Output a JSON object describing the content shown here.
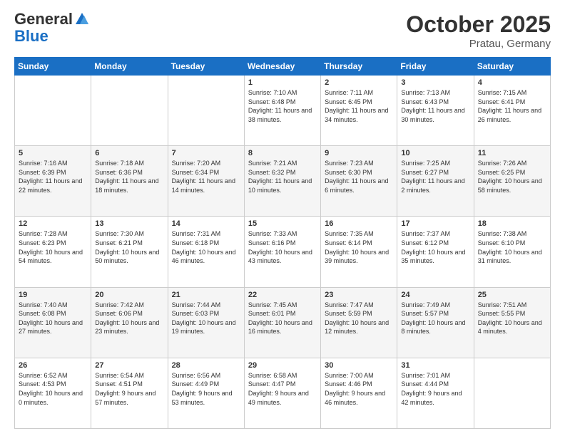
{
  "header": {
    "logo_general": "General",
    "logo_blue": "Blue",
    "month_title": "October 2025",
    "location": "Pratau, Germany"
  },
  "days_of_week": [
    "Sunday",
    "Monday",
    "Tuesday",
    "Wednesday",
    "Thursday",
    "Friday",
    "Saturday"
  ],
  "weeks": [
    [
      {
        "day": "",
        "sunrise": "",
        "sunset": "",
        "daylight": ""
      },
      {
        "day": "",
        "sunrise": "",
        "sunset": "",
        "daylight": ""
      },
      {
        "day": "",
        "sunrise": "",
        "sunset": "",
        "daylight": ""
      },
      {
        "day": "1",
        "sunrise": "Sunrise: 7:10 AM",
        "sunset": "Sunset: 6:48 PM",
        "daylight": "Daylight: 11 hours and 38 minutes."
      },
      {
        "day": "2",
        "sunrise": "Sunrise: 7:11 AM",
        "sunset": "Sunset: 6:45 PM",
        "daylight": "Daylight: 11 hours and 34 minutes."
      },
      {
        "day": "3",
        "sunrise": "Sunrise: 7:13 AM",
        "sunset": "Sunset: 6:43 PM",
        "daylight": "Daylight: 11 hours and 30 minutes."
      },
      {
        "day": "4",
        "sunrise": "Sunrise: 7:15 AM",
        "sunset": "Sunset: 6:41 PM",
        "daylight": "Daylight: 11 hours and 26 minutes."
      }
    ],
    [
      {
        "day": "5",
        "sunrise": "Sunrise: 7:16 AM",
        "sunset": "Sunset: 6:39 PM",
        "daylight": "Daylight: 11 hours and 22 minutes."
      },
      {
        "day": "6",
        "sunrise": "Sunrise: 7:18 AM",
        "sunset": "Sunset: 6:36 PM",
        "daylight": "Daylight: 11 hours and 18 minutes."
      },
      {
        "day": "7",
        "sunrise": "Sunrise: 7:20 AM",
        "sunset": "Sunset: 6:34 PM",
        "daylight": "Daylight: 11 hours and 14 minutes."
      },
      {
        "day": "8",
        "sunrise": "Sunrise: 7:21 AM",
        "sunset": "Sunset: 6:32 PM",
        "daylight": "Daylight: 11 hours and 10 minutes."
      },
      {
        "day": "9",
        "sunrise": "Sunrise: 7:23 AM",
        "sunset": "Sunset: 6:30 PM",
        "daylight": "Daylight: 11 hours and 6 minutes."
      },
      {
        "day": "10",
        "sunrise": "Sunrise: 7:25 AM",
        "sunset": "Sunset: 6:27 PM",
        "daylight": "Daylight: 11 hours and 2 minutes."
      },
      {
        "day": "11",
        "sunrise": "Sunrise: 7:26 AM",
        "sunset": "Sunset: 6:25 PM",
        "daylight": "Daylight: 10 hours and 58 minutes."
      }
    ],
    [
      {
        "day": "12",
        "sunrise": "Sunrise: 7:28 AM",
        "sunset": "Sunset: 6:23 PM",
        "daylight": "Daylight: 10 hours and 54 minutes."
      },
      {
        "day": "13",
        "sunrise": "Sunrise: 7:30 AM",
        "sunset": "Sunset: 6:21 PM",
        "daylight": "Daylight: 10 hours and 50 minutes."
      },
      {
        "day": "14",
        "sunrise": "Sunrise: 7:31 AM",
        "sunset": "Sunset: 6:18 PM",
        "daylight": "Daylight: 10 hours and 46 minutes."
      },
      {
        "day": "15",
        "sunrise": "Sunrise: 7:33 AM",
        "sunset": "Sunset: 6:16 PM",
        "daylight": "Daylight: 10 hours and 43 minutes."
      },
      {
        "day": "16",
        "sunrise": "Sunrise: 7:35 AM",
        "sunset": "Sunset: 6:14 PM",
        "daylight": "Daylight: 10 hours and 39 minutes."
      },
      {
        "day": "17",
        "sunrise": "Sunrise: 7:37 AM",
        "sunset": "Sunset: 6:12 PM",
        "daylight": "Daylight: 10 hours and 35 minutes."
      },
      {
        "day": "18",
        "sunrise": "Sunrise: 7:38 AM",
        "sunset": "Sunset: 6:10 PM",
        "daylight": "Daylight: 10 hours and 31 minutes."
      }
    ],
    [
      {
        "day": "19",
        "sunrise": "Sunrise: 7:40 AM",
        "sunset": "Sunset: 6:08 PM",
        "daylight": "Daylight: 10 hours and 27 minutes."
      },
      {
        "day": "20",
        "sunrise": "Sunrise: 7:42 AM",
        "sunset": "Sunset: 6:06 PM",
        "daylight": "Daylight: 10 hours and 23 minutes."
      },
      {
        "day": "21",
        "sunrise": "Sunrise: 7:44 AM",
        "sunset": "Sunset: 6:03 PM",
        "daylight": "Daylight: 10 hours and 19 minutes."
      },
      {
        "day": "22",
        "sunrise": "Sunrise: 7:45 AM",
        "sunset": "Sunset: 6:01 PM",
        "daylight": "Daylight: 10 hours and 16 minutes."
      },
      {
        "day": "23",
        "sunrise": "Sunrise: 7:47 AM",
        "sunset": "Sunset: 5:59 PM",
        "daylight": "Daylight: 10 hours and 12 minutes."
      },
      {
        "day": "24",
        "sunrise": "Sunrise: 7:49 AM",
        "sunset": "Sunset: 5:57 PM",
        "daylight": "Daylight: 10 hours and 8 minutes."
      },
      {
        "day": "25",
        "sunrise": "Sunrise: 7:51 AM",
        "sunset": "Sunset: 5:55 PM",
        "daylight": "Daylight: 10 hours and 4 minutes."
      }
    ],
    [
      {
        "day": "26",
        "sunrise": "Sunrise: 6:52 AM",
        "sunset": "Sunset: 4:53 PM",
        "daylight": "Daylight: 10 hours and 0 minutes."
      },
      {
        "day": "27",
        "sunrise": "Sunrise: 6:54 AM",
        "sunset": "Sunset: 4:51 PM",
        "daylight": "Daylight: 9 hours and 57 minutes."
      },
      {
        "day": "28",
        "sunrise": "Sunrise: 6:56 AM",
        "sunset": "Sunset: 4:49 PM",
        "daylight": "Daylight: 9 hours and 53 minutes."
      },
      {
        "day": "29",
        "sunrise": "Sunrise: 6:58 AM",
        "sunset": "Sunset: 4:47 PM",
        "daylight": "Daylight: 9 hours and 49 minutes."
      },
      {
        "day": "30",
        "sunrise": "Sunrise: 7:00 AM",
        "sunset": "Sunset: 4:46 PM",
        "daylight": "Daylight: 9 hours and 46 minutes."
      },
      {
        "day": "31",
        "sunrise": "Sunrise: 7:01 AM",
        "sunset": "Sunset: 4:44 PM",
        "daylight": "Daylight: 9 hours and 42 minutes."
      },
      {
        "day": "",
        "sunrise": "",
        "sunset": "",
        "daylight": ""
      }
    ]
  ]
}
